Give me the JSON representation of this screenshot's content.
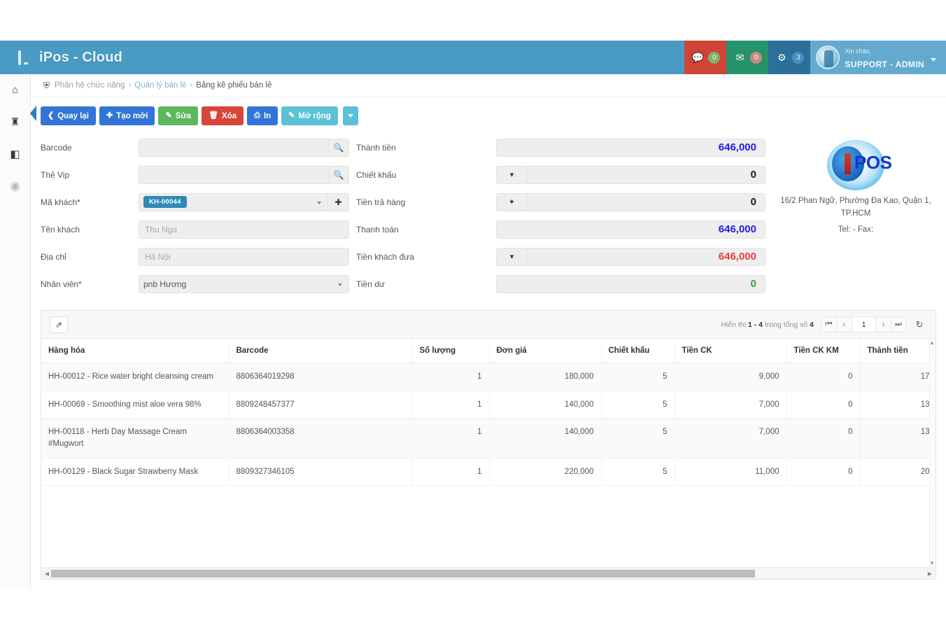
{
  "app": {
    "title": "iPos - Cloud",
    "brand_icon": "monitor-icon"
  },
  "header": {
    "tiles": [
      {
        "icon": "comment-icon",
        "badge": "0",
        "color": "#cf4436"
      },
      {
        "icon": "envelope-icon",
        "badge": "0",
        "color": "#27936a"
      },
      {
        "icon": "tasks-icon",
        "badge": "3",
        "color": "#2c6f9b"
      }
    ],
    "user": {
      "greeting": "Xin chào,",
      "name": "SUPPORT - ADMIN",
      "caret": "chevron-down-icon"
    }
  },
  "rail": {
    "items": [
      {
        "name": "home-icon",
        "glyph": "⌂"
      },
      {
        "name": "group-icon",
        "glyph": "♜"
      },
      {
        "name": "book-icon",
        "glyph": "◧"
      },
      {
        "name": "circle-icon",
        "glyph": "◉"
      }
    ]
  },
  "breadcrumb": {
    "icon": "sitemap-icon",
    "root": "Phân hệ chức năng",
    "sep1": "›",
    "level2": "Quản lý bán lẻ",
    "sep2": "›",
    "current": "Bảng kê phiếu bán lẻ"
  },
  "toolbar": {
    "back_label": "Quay lại",
    "new_label": "Tạo mới",
    "edit_label": "Sửa",
    "delete_label": "Xóa",
    "print_label": "In",
    "expand_label": "Mở rộng",
    "split_caret": "chevron-down-icon"
  },
  "form": {
    "left": [
      {
        "label": "Barcode",
        "value": "",
        "placeholder": "",
        "type": "search"
      },
      {
        "label": "Thẻ Vip",
        "value": "",
        "placeholder": "",
        "type": "search"
      },
      {
        "label": "Mã khách*",
        "value": "KH-00044",
        "type": "tag-select"
      },
      {
        "label": "Tên khách",
        "value": "",
        "placeholder": "Thu Nga",
        "type": "text"
      },
      {
        "label": "Địa chỉ",
        "value": "",
        "placeholder": "Hà Nội",
        "type": "text"
      },
      {
        "label": "Nhân viên*",
        "value": "pnb Hương",
        "type": "select"
      }
    ],
    "right": [
      {
        "label": "Thành tiền",
        "value": "646,000",
        "color": "blue",
        "prefix": null
      },
      {
        "label": "Chiết khấu",
        "value": "0",
        "color": "dark",
        "prefix": "chevron-down-icon"
      },
      {
        "label": "Tiền trả hàng",
        "value": "0",
        "color": "dark",
        "prefix": "move-icon"
      },
      {
        "label": "Thanh toán",
        "value": "646,000",
        "color": "blue",
        "prefix": null
      },
      {
        "label": "Tiền khách đưa",
        "value": "646,000",
        "color": "red",
        "prefix": "chevron-down-icon"
      },
      {
        "label": "Tiền dư",
        "value": "0",
        "color": "green",
        "prefix": null
      }
    ]
  },
  "company": {
    "logo_text": "POS",
    "address": "16/2 Phan Ngữ, Phường Đa Kao, Quận 1, TP.HCM",
    "tel": "Tel: - Fax:"
  },
  "grid": {
    "expand_icon": "expand-arrows-icon",
    "pager": {
      "info_prefix": "Hiển thị",
      "info_range": "1 - 4",
      "info_middle": "trong tổng số",
      "info_total": "4",
      "first": "⏮",
      "prev": "‹",
      "current_page": "1",
      "next": "›",
      "last": "⏭",
      "refresh": "↻"
    },
    "columns": [
      "Hàng hóa",
      "Barcode",
      "Số lượng",
      "Đơn giá",
      "Chiết khấu",
      "Tiền CK",
      "Tiền CK KM",
      "Thành tiền"
    ],
    "rows": [
      {
        "name": "HH-00012 - Rice water bright cleansing cream",
        "barcode": "8806364019298",
        "qty": "1",
        "price": "180,000",
        "discount": "5",
        "ck": "9,000",
        "ck_km": "0",
        "total": "17"
      },
      {
        "name": "HH-00069 - Smoothing mist aloe vera 98%",
        "barcode": "8809248457377",
        "qty": "1",
        "price": "140,000",
        "discount": "5",
        "ck": "7,000",
        "ck_km": "0",
        "total": "13"
      },
      {
        "name": "HH-00118 - Herb Day Massage Cream #Mugwort",
        "barcode": "8806364003358",
        "qty": "1",
        "price": "140,000",
        "discount": "5",
        "ck": "7,000",
        "ck_km": "0",
        "total": "13"
      },
      {
        "name": "HH-00129 - Black Sugar Strawberry Mask",
        "barcode": "8809327346105",
        "qty": "1",
        "price": "220,000",
        "discount": "5",
        "ck": "11,000",
        "ck_km": "0",
        "total": "20"
      }
    ]
  }
}
